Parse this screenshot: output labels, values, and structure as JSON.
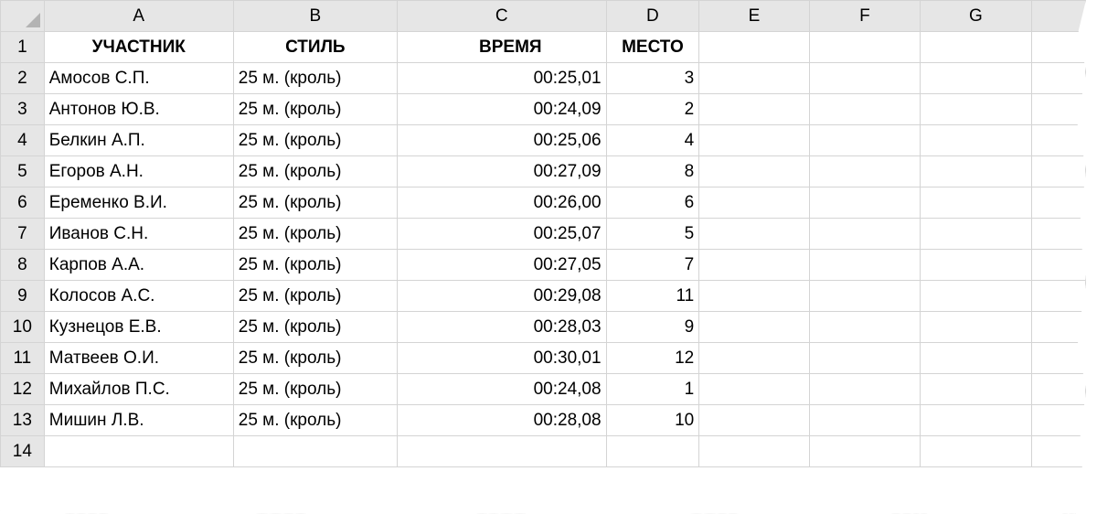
{
  "columns": [
    "A",
    "B",
    "C",
    "D",
    "E",
    "F",
    "G"
  ],
  "header_row": {
    "num": "1",
    "a": "УЧАСТНИК",
    "b": "СТИЛЬ",
    "c": "ВРЕМЯ",
    "d": "МЕСТО"
  },
  "rows": [
    {
      "num": "2",
      "name": "Амосов С.П.",
      "style": "25 м. (кроль)",
      "time": "00:25,01",
      "place": "3"
    },
    {
      "num": "3",
      "name": "Антонов Ю.В.",
      "style": "25 м. (кроль)",
      "time": "00:24,09",
      "place": "2"
    },
    {
      "num": "4",
      "name": "Белкин А.П.",
      "style": "25 м. (кроль)",
      "time": "00:25,06",
      "place": "4"
    },
    {
      "num": "5",
      "name": "Егоров А.Н.",
      "style": "25 м. (кроль)",
      "time": "00:27,09",
      "place": "8"
    },
    {
      "num": "6",
      "name": "Еременко В.И.",
      "style": "25 м. (кроль)",
      "time": "00:26,00",
      "place": "6"
    },
    {
      "num": "7",
      "name": "Иванов С.Н.",
      "style": "25 м. (кроль)",
      "time": "00:25,07",
      "place": "5"
    },
    {
      "num": "8",
      "name": "Карпов А.А.",
      "style": "25 м. (кроль)",
      "time": "00:27,05",
      "place": "7"
    },
    {
      "num": "9",
      "name": "Колосов А.С.",
      "style": "25 м. (кроль)",
      "time": "00:29,08",
      "place": "11"
    },
    {
      "num": "10",
      "name": "Кузнецов Е.В.",
      "style": "25 м. (кроль)",
      "time": "00:28,03",
      "place": "9"
    },
    {
      "num": "11",
      "name": "Матвеев О.И.",
      "style": "25 м. (кроль)",
      "time": "00:30,01",
      "place": "12"
    },
    {
      "num": "12",
      "name": "Михайлов П.С.",
      "style": "25 м. (кроль)",
      "time": "00:24,08",
      "place": "1"
    },
    {
      "num": "13",
      "name": "Мишин Л.В.",
      "style": "25 м. (кроль)",
      "time": "00:28,08",
      "place": "10"
    }
  ],
  "last_row": {
    "num": "14"
  }
}
